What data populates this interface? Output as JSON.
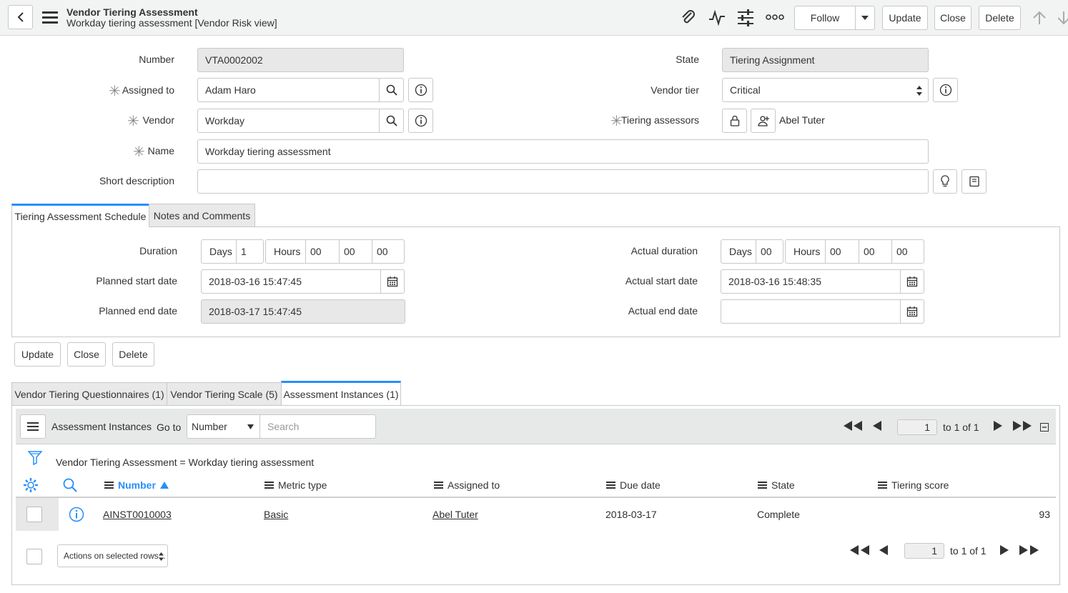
{
  "header": {
    "title": "Vendor Tiering Assessment",
    "subtitle": "Workday tiering assessment [Vendor Risk view]",
    "follow_label": "Follow",
    "update_label": "Update",
    "close_label": "Close",
    "delete_label": "Delete"
  },
  "form": {
    "number_label": "Number",
    "number_value": "VTA0002002",
    "assigned_to_label": "Assigned to",
    "assigned_to_value": "Adam Haro",
    "vendor_label": "Vendor",
    "vendor_value": "Workday",
    "name_label": "Name",
    "name_value": "Workday tiering assessment",
    "short_description_label": "Short description",
    "short_description_value": "",
    "state_label": "State",
    "state_value": "Tiering Assignment",
    "vendor_tier_label": "Vendor tier",
    "vendor_tier_value": "Critical",
    "tiering_assessors_label": "Tiering assessors",
    "tiering_assessors_value": "Abel Tuter"
  },
  "section_tabs": [
    {
      "label": "Tiering Assessment Schedule",
      "active": true
    },
    {
      "label": "Notes and Comments",
      "active": false
    }
  ],
  "schedule": {
    "duration_label": "Duration",
    "days_label": "Days",
    "hours_label": "Hours",
    "duration_days": "1",
    "duration_hours": "00",
    "duration_minutes": "00",
    "duration_seconds": "00",
    "planned_start_label": "Planned start date",
    "planned_start_value": "2018-03-16 15:47:45",
    "planned_end_label": "Planned end date",
    "planned_end_value": "2018-03-17 15:47:45",
    "actual_duration_label": "Actual duration",
    "actual_days": "00",
    "actual_hours": "00",
    "actual_minutes": "00",
    "actual_seconds": "00",
    "actual_start_label": "Actual start date",
    "actual_start_value": "2018-03-16 15:48:35",
    "actual_end_label": "Actual end date",
    "actual_end_value": ""
  },
  "form_buttons": {
    "update": "Update",
    "close": "Close",
    "delete": "Delete"
  },
  "related_tabs": [
    {
      "label": "Vendor Tiering Questionnaires (1)",
      "active": false
    },
    {
      "label": "Vendor Tiering Scale (5)",
      "active": false
    },
    {
      "label": "Assessment Instances (1)",
      "active": true
    }
  ],
  "list": {
    "title": "Assessment Instances",
    "goto_label": "Go to",
    "goto_field": "Number",
    "search_placeholder": "Search",
    "page_value": "1",
    "page_range": "to 1 of 1",
    "filter_text": "Vendor Tiering Assessment = Workday tiering assessment",
    "columns": [
      "Number",
      "Metric type",
      "Assigned to",
      "Due date",
      "State",
      "Tiering score"
    ],
    "rows": [
      {
        "number": "AINST0010003",
        "metric_type": "Basic",
        "assigned_to": "Abel Tuter",
        "due_date": "2018-03-17",
        "state": "Complete",
        "tiering_score": "93"
      }
    ],
    "actions_label": "Actions on selected rows...",
    "footer_page_value": "1",
    "footer_page_range": "to 1 of 1"
  },
  "colors": {
    "accent": "#278efc",
    "header_bg": "#f2f3f3",
    "readonly_bg": "#e8e8e8"
  }
}
